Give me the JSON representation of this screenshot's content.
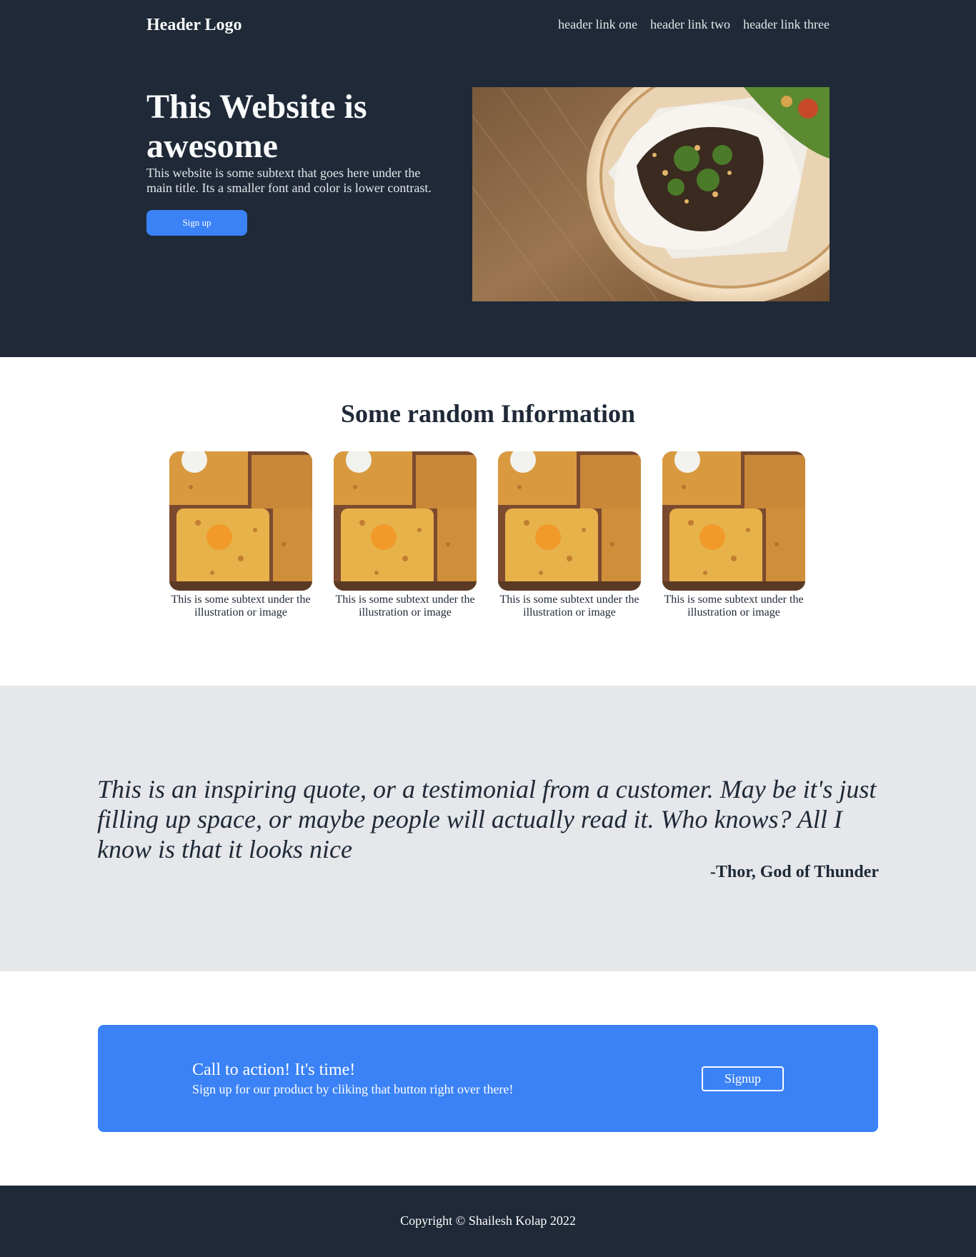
{
  "colors": {
    "dark_bg": "#1f2937",
    "accent": "#3b82f6",
    "light_gray_bg": "#e5e7eb",
    "white": "#ffffff"
  },
  "header": {
    "logo": "Header Logo",
    "links": [
      "header link one",
      "header link two",
      "header link three"
    ]
  },
  "hero": {
    "title": "This Website is awesome",
    "subtext": "This website is some subtext that goes here under the main title. Its a smaller font and color is lower contrast.",
    "button_label": "Sign up",
    "image": "food-bao-bun-image"
  },
  "info": {
    "title": "Some random Information",
    "cards": [
      {
        "image": "food-casserole-image",
        "caption": "This is some subtext under the illustration or image"
      },
      {
        "image": "food-casserole-image",
        "caption": "This is some subtext under the illustration or image"
      },
      {
        "image": "food-casserole-image",
        "caption": "This is some subtext under the illustration or image"
      },
      {
        "image": "food-casserole-image",
        "caption": "This is some subtext under the illustration or image"
      }
    ]
  },
  "quote": {
    "text": "This is an inspiring quote, or a testimonial from a customer. May be it's just filling up space, or maybe people will actually read it. Who knows? All I know is that it looks nice",
    "author": "-Thor, God of Thunder"
  },
  "cta": {
    "title": "Call to action! It's time!",
    "subtext": "Sign up for our product by cliking that button right over there!",
    "button_label": "Signup"
  },
  "footer": {
    "copyright": "Copyright © Shailesh Kolap 2022"
  }
}
